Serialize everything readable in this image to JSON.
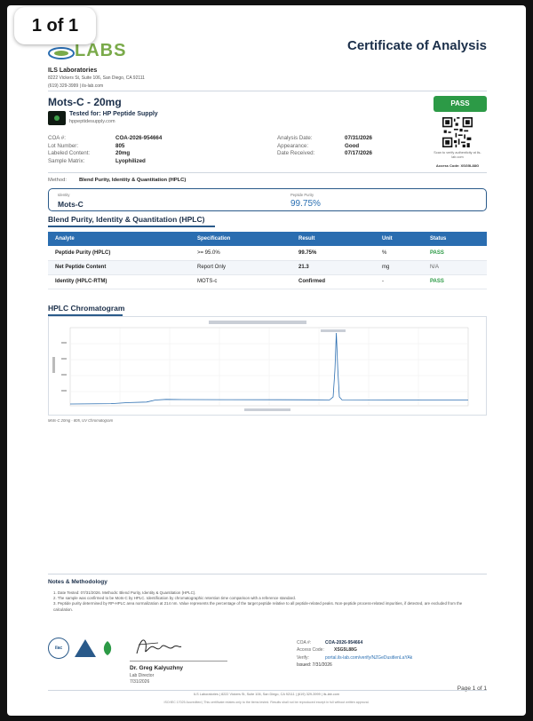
{
  "page_badge": "1 of 1",
  "header": {
    "logo_text": "LABS",
    "title": "Certificate of Analysis"
  },
  "lab": {
    "name": "ILS Laboratories",
    "address": "8222 Vickers St, Suite 106, San Diego, CA 92111",
    "contact": "(619) 329-3999  |  ils-lab.com"
  },
  "product": {
    "name": "Mots-C - 20mg",
    "tested_for": "Tested for: HP Peptide Supply",
    "client_url": "hppeptidesupply.com"
  },
  "status": {
    "badge": "PASS",
    "qr_caption": "Scan to verify authenticity at ils-lab.com",
    "access_code": "Access Code: XSG5L88G"
  },
  "meta_left": [
    {
      "label": "COA #:",
      "value": "COA-2026-954664"
    },
    {
      "label": "Lot Number:",
      "value": "805"
    },
    {
      "label": "Labeled Content:",
      "value": "20mg"
    },
    {
      "label": "Sample Matrix:",
      "value": "Lyophilized"
    }
  ],
  "meta_right": [
    {
      "label": "Analysis Date:",
      "value": "07/31/2026"
    },
    {
      "label": "Appearance:",
      "value": "Good"
    },
    {
      "label": "Date Received:",
      "value": "07/17/2026"
    }
  ],
  "method": {
    "label": "Method:",
    "value": "Blend Purity, Identity & Quantitation (HPLC)"
  },
  "summary": {
    "identity_label": "Identity",
    "identity_value": "Mots-C",
    "purity_label": "Peptide Purity",
    "purity_value": "99.75%"
  },
  "results_section": {
    "title": "Blend Purity, Identity & Quantitation (HPLC)",
    "headers": [
      "Analyte",
      "Specification",
      "Result",
      "Unit",
      "Status"
    ],
    "rows": [
      [
        "Peptide Purity (HPLC)",
        ">= 95.0%",
        "99.75%",
        "%",
        "PASS"
      ],
      [
        "Net Peptide Content",
        "Report Only",
        "21.3",
        "mg",
        "N/A"
      ],
      [
        "Identity (HPLC-RTM)",
        "MOTS-c",
        "Confirmed",
        "-",
        "PASS"
      ]
    ]
  },
  "chromatogram": {
    "section_title": "HPLC Chromatogram",
    "caption": "Mots-C 20mg - 805, UV Chromatogram"
  },
  "notes": {
    "title": "Notes & Methodology",
    "items": [
      "1. Date Tested: 07/31/2026. Methods: Blend Purity, Identity & Quantitation (HPLC).",
      "2. The sample was confirmed to be Mots-C by HPLC. Identification by chromatographic retention time comparison with a reference standard.",
      "3. Peptide purity determined by RP-HPLC area normalization at 214 nm. Value represents the percentage of the target peptide relative to all peptide-related peaks. Non-peptide process-related impurities, if detected, are excluded from the calculation."
    ]
  },
  "signature": {
    "name": "Dr. Greg Kalyuzhny",
    "title": "Lab Director",
    "date": "7/31/2026"
  },
  "verification": {
    "coa_label": "COA #:",
    "coa_value": "COA-2026-954664",
    "access_label": "Access Code:",
    "access_value": "XSG5L88G",
    "verify_label": "Verify:",
    "verify_value": "portal.ils-lab.com/verify/NZGeDusitlenLaYAk",
    "issued": "Issued: 7/31/2026"
  },
  "footer": {
    "page": "Page 1 of 1",
    "line1": "ILS Laboratories  |  8222 Vickers St, Suite 106, San Diego, CA 92111  |  (619) 329-3999  |  ils-lab.com",
    "line2": "ISO/IEC 17025 Accredited  |  This certificate relates only to the items tested. Results shall not be reproduced except in full without written approval."
  },
  "colors": {
    "navy": "#1b2f4a",
    "blue": "#2a6db0",
    "pass_green": "#2c9a46",
    "logo_green": "#7aaa4a"
  }
}
